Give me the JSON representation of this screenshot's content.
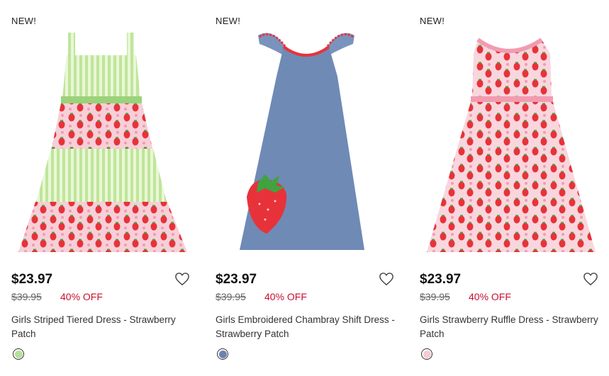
{
  "products": [
    {
      "badge": "NEW!",
      "price": "$23.97",
      "original_price": "$39.95",
      "discount": "40% OFF",
      "name": "Girls Striped Tiered Dress - Strawberry Patch",
      "swatch_color": "#b7df9a",
      "image": "striped-tiered-strawberry-dress"
    },
    {
      "badge": "NEW!",
      "price": "$23.97",
      "original_price": "$39.95",
      "discount": "40% OFF",
      "name": "Girls Embroidered Chambray Shift Dress - Strawberry Patch",
      "swatch_color": "#6a84ad",
      "image": "chambray-shift-strawberry-dress"
    },
    {
      "badge": "NEW!",
      "price": "$23.97",
      "original_price": "$39.95",
      "discount": "40% OFF",
      "name": "Girls Strawberry Ruffle Dress - Strawberry Patch",
      "swatch_color": "#f6cbd3",
      "image": "strawberry-ruffle-dress"
    }
  ],
  "colors": {
    "sale": "#c8102e",
    "text": "#1a1a1a"
  }
}
